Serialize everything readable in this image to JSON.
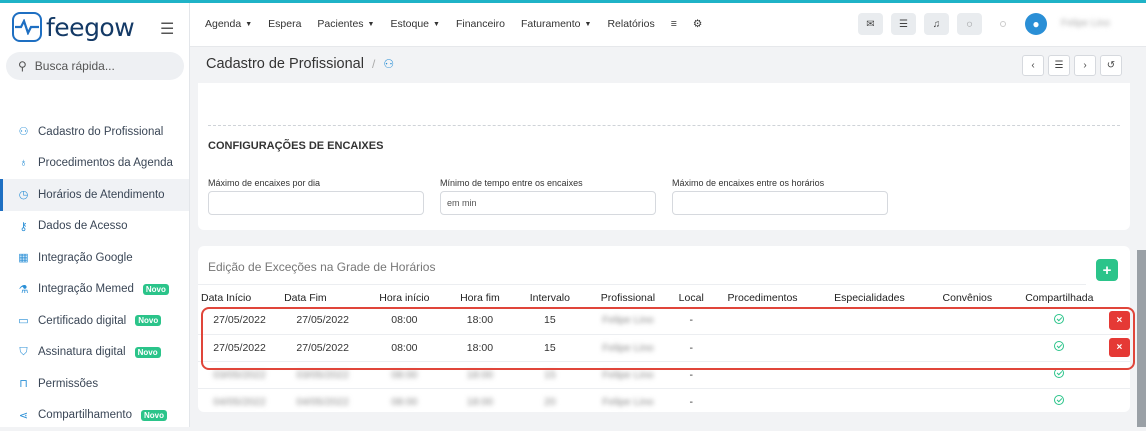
{
  "brand": {
    "name": "feegow"
  },
  "search": {
    "placeholder": "Busca rápida..."
  },
  "sidebar": {
    "items": [
      {
        "label": "Cadastro do Profissional",
        "icon": "user-icon"
      },
      {
        "label": "Procedimentos da Agenda",
        "icon": "stethoscope-icon"
      },
      {
        "label": "Horários de Atendimento",
        "icon": "clock-icon",
        "active": true
      },
      {
        "label": "Dados de Acesso",
        "icon": "key-icon"
      },
      {
        "label": "Integração Google",
        "icon": "calendar-icon"
      },
      {
        "label": "Integração Memed",
        "icon": "flask-icon",
        "badge": "Novo"
      },
      {
        "label": "Certificado digital",
        "icon": "card-icon",
        "badge": "Novo"
      },
      {
        "label": "Assinatura digital",
        "icon": "shield-icon",
        "badge": "Novo"
      },
      {
        "label": "Permissões",
        "icon": "lock-icon"
      },
      {
        "label": "Compartilhamento",
        "icon": "share-icon",
        "badge": "Novo"
      }
    ]
  },
  "nav": {
    "items": [
      "Agenda",
      "Espera",
      "Pacientes",
      "Estoque",
      "Financeiro",
      "Faturamento",
      "Relatórios"
    ]
  },
  "user": {
    "name": "Felipe Lino"
  },
  "page": {
    "title": "Cadastro de Profissional"
  },
  "encaixes": {
    "title": "CONFIGURAÇÕES DE ENCAIXES",
    "f1_label": "Máximo de encaixes por dia",
    "f2_label": "Mínimo de tempo entre os encaixes",
    "f2_placeholder": "em min",
    "f3_label": "Máximo de encaixes entre os horários"
  },
  "excecoes": {
    "title": "Edição de Exceções na Grade de Horários",
    "columns": [
      "Data Início",
      "Data Fim",
      "Hora início",
      "Hora fim",
      "Intervalo",
      "Profissional",
      "Local",
      "Procedimentos",
      "Especialidades",
      "Convênios",
      "Compartilhada"
    ],
    "rows": [
      {
        "data_inicio": "27/05/2022",
        "data_fim": "27/05/2022",
        "hora_inicio": "08:00",
        "hora_fim": "18:00",
        "intervalo": "15",
        "profissional": "Felipe Lino",
        "local": "-"
      },
      {
        "data_inicio": "27/05/2022",
        "data_fim": "27/05/2022",
        "hora_inicio": "08:00",
        "hora_fim": "18:00",
        "intervalo": "15",
        "profissional": "Felipe Lino",
        "local": "-"
      },
      {
        "data_inicio": "03/05/2022",
        "data_fim": "03/05/2022",
        "hora_inicio": "08:00",
        "hora_fim": "18:00",
        "intervalo": "15",
        "profissional": "Felipe Lino",
        "local": "-"
      },
      {
        "data_inicio": "04/05/2022",
        "data_fim": "04/05/2022",
        "hora_inicio": "08:00",
        "hora_fim": "18:00",
        "intervalo": "20",
        "profissional": "Felipe Lino",
        "local": "-"
      }
    ]
  },
  "colors": {
    "accent": "#1e6fc2",
    "green": "#2bc48a",
    "red": "#e53935",
    "highlight": "#e0453a"
  }
}
